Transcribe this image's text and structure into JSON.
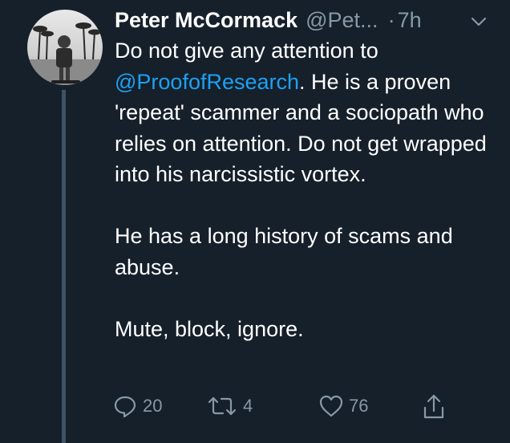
{
  "tweet": {
    "author_name": "Peter McCormack",
    "author_handle": "@Pet...",
    "separator": "·",
    "time": "7h",
    "text_before_mention": "Do not give any attention to ",
    "mention": "@ProofofResearch",
    "text_after_mention": ". He is a proven 'repeat' scammer and a sociopath who relies on attention. Do not get wrapped into his narcissistic vortex.",
    "paragraph_2": "He has a long history of scams and abuse.",
    "paragraph_3": "Mute, block, ignore."
  },
  "actions": {
    "reply_count": "20",
    "retweet_count": "4",
    "like_count": "76"
  },
  "icons": {
    "reply": "reply-icon",
    "retweet": "retweet-icon",
    "like": "heart-icon",
    "share": "share-icon",
    "menu": "chevron-down-icon"
  },
  "colors": {
    "background": "#15202b",
    "text": "#ffffff",
    "secondary": "#8899a6",
    "link": "#1da1f2"
  }
}
